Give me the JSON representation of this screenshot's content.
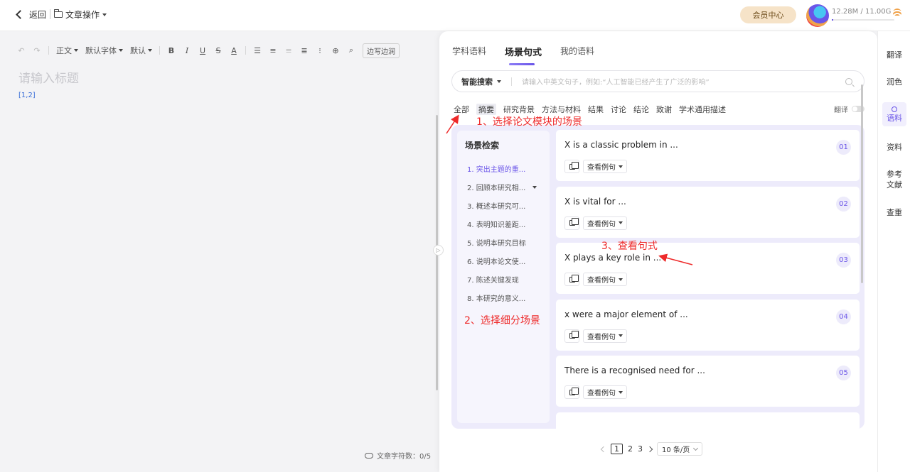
{
  "topbar": {
    "back_label": "返回",
    "doc_label": "文章操作",
    "member_label": "会员中心",
    "storage_text": "12.28M / 11.00G",
    "storage_used_fraction": 0.001
  },
  "editor": {
    "toolbar": {
      "paragraph_style": "正文",
      "font_family": "默认字体",
      "font_size": "默认",
      "bold": "B",
      "italic": "I",
      "underline": "U",
      "strike": "S",
      "font_color": "A",
      "outline_label": "边写边润"
    },
    "title_placeholder": "请输入标题",
    "citation": "[1,2]",
    "word_count_label": "文章字符数：0/5"
  },
  "panel": {
    "tabs": [
      "学科语料",
      "场景句式",
      "我的语料"
    ],
    "active_tab": "场景句式",
    "search": {
      "mode": "智能搜索",
      "placeholder": "请输入中英文句子，例如:“人工智能已经产生了广泛的影响”"
    },
    "categories": [
      "全部",
      "摘要",
      "研究背景",
      "方法与材料",
      "结果",
      "讨论",
      "结论",
      "致谢",
      "学术通用描述"
    ],
    "active_category": "摘要",
    "translate_label": "翻译",
    "scene": {
      "title": "场景检索",
      "items": [
        "1. 突出主题的重...",
        "2. 回顾本研究相...",
        "3. 概述本研究可...",
        "4. 表明知识差距...",
        "5. 说明本研究目标",
        "6. 说明本论文使...",
        "7. 陈述关键发现",
        "8. 本研究的意义..."
      ]
    },
    "sentences": [
      {
        "text": "X is a classic problem in ...",
        "num": "01"
      },
      {
        "text": "X is vital for ...",
        "num": "02"
      },
      {
        "text": "X plays a key role in ...",
        "num": "03"
      },
      {
        "text": "x were a major element of ...",
        "num": "04"
      },
      {
        "text": "There is a recognised need for ...",
        "num": "05"
      }
    ],
    "example_label": "查看例句",
    "pager": {
      "pages": [
        "1",
        "2",
        "3"
      ],
      "active": "1",
      "size_label": "10 条/页"
    }
  },
  "rail": {
    "items": [
      "翻译",
      "润色",
      "语料",
      "资料",
      "参考\n文献",
      "查重"
    ],
    "active": "语料"
  },
  "annotations": {
    "step1": "1、选择论文模块的场景",
    "step2": "2、选择细分场景",
    "step3": "3、查看句式"
  },
  "colors": {
    "accent": "#6a55e8",
    "annotation": "#ee2a2a",
    "member_bg": "#f6e3c8"
  }
}
